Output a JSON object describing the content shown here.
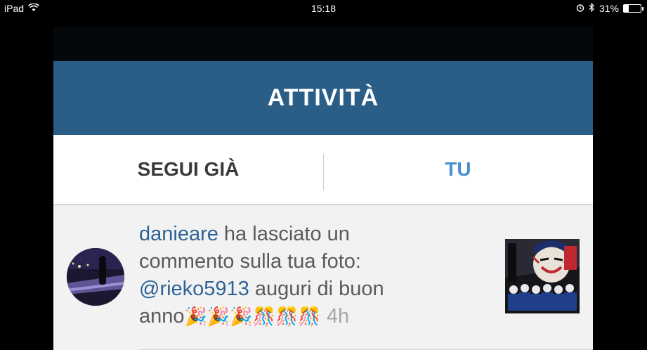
{
  "status_bar": {
    "device": "iPad",
    "time": "15:18",
    "battery": "31%",
    "battery_level": 0.31
  },
  "header": {
    "title": "ATTIVITÀ"
  },
  "tabs": [
    {
      "label": "SEGUI GIÀ",
      "active": false
    },
    {
      "label": "TU",
      "active": true
    }
  ],
  "feed": [
    {
      "username": "danieare",
      "action": " ha lasciato un commento sulla tua foto: ",
      "mention": "@rieko5913",
      "comment": " auguri di buon anno",
      "emojis": "🎉🎉🎉🎊🎊🎊",
      "time": "4h"
    }
  ],
  "colors": {
    "header_bg": "#2b5e87",
    "active_tab": "#4a8fcf",
    "link": "#2d6396"
  }
}
